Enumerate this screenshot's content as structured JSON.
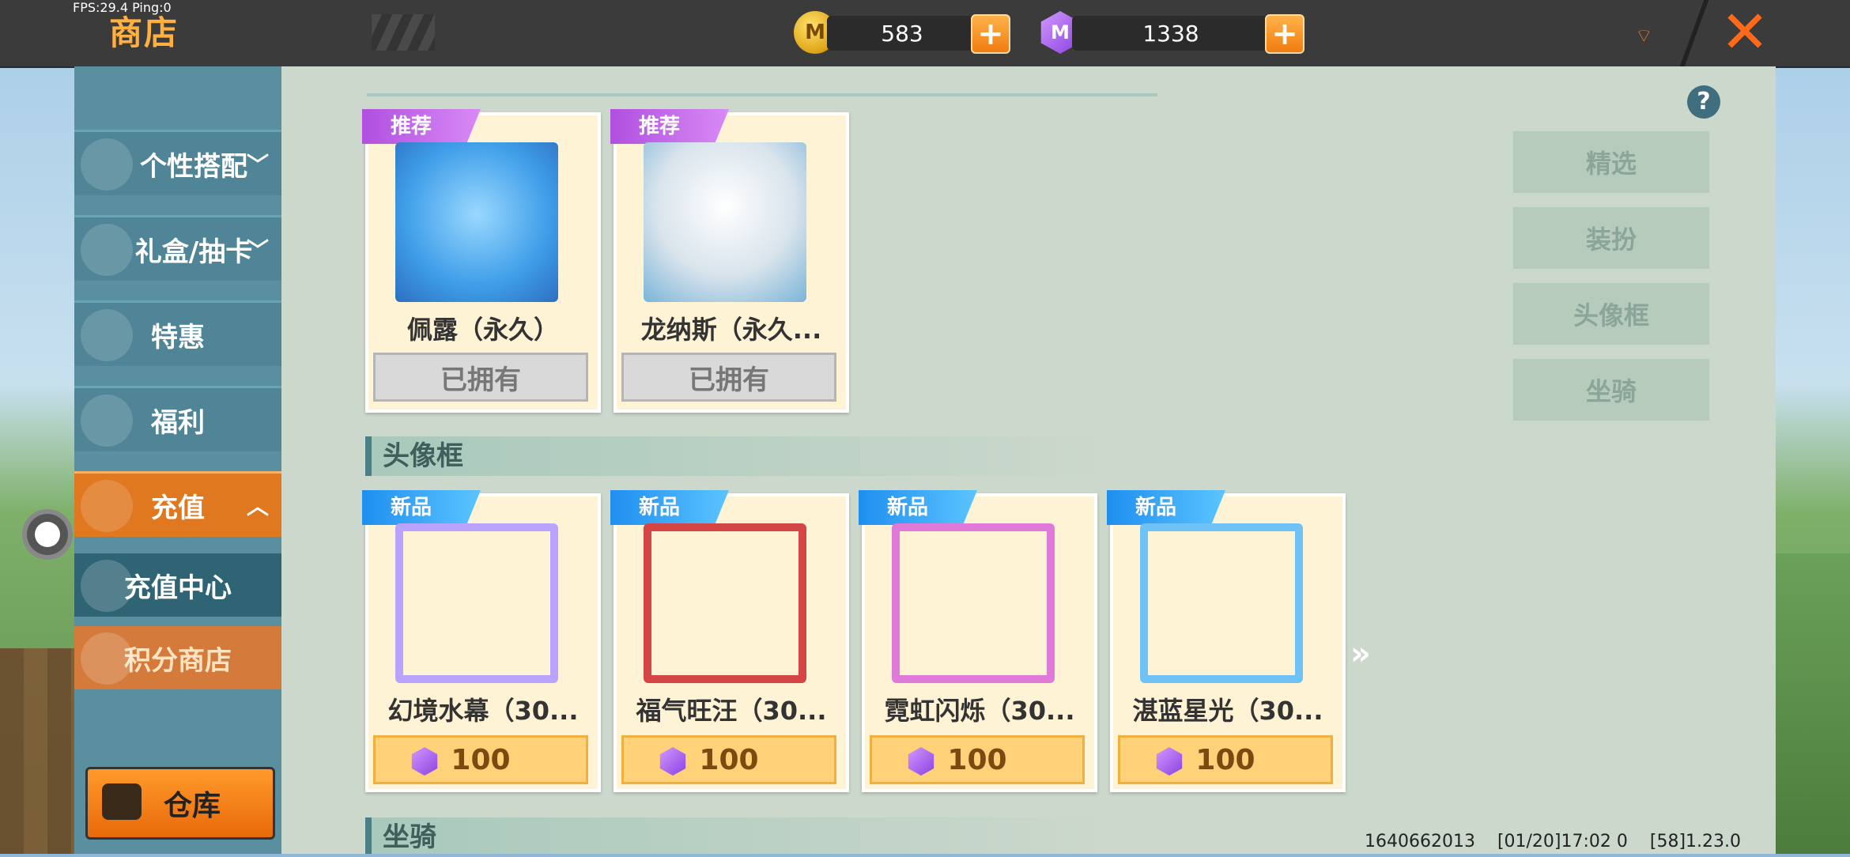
{
  "status": {
    "fps": "FPS:29.4  Ping:0"
  },
  "header": {
    "title": "商店",
    "coins": "583",
    "coin_icon_letter": "M",
    "gems": "1338",
    "gem_icon_letter": "M",
    "add_symbol": "+",
    "close_symbol": "✕",
    "rss_symbol": "⌔"
  },
  "sidebar": {
    "items": [
      {
        "label": "个性搭配",
        "icon": "trophy-icon",
        "chevron": "﹀"
      },
      {
        "label": "礼盒/抽卡",
        "icon": "wheel-icon",
        "chevron": "﹀"
      },
      {
        "label": "特惠",
        "icon": "box-icon"
      },
      {
        "label": "福利",
        "icon": "gift-icon"
      },
      {
        "label": "充值",
        "icon": "coins-icon",
        "chevron": "︿"
      }
    ],
    "sub_items": [
      {
        "label": "充值中心",
        "icon": "coins-icon"
      },
      {
        "label": "积分商店",
        "icon": "points-icon"
      }
    ],
    "warehouse_label": "仓库"
  },
  "filters": [
    "精选",
    "装扮",
    "头像框",
    "坐骑"
  ],
  "help_label": "?",
  "recommended": [
    {
      "tag": "推荐",
      "name": "佩露（永久）",
      "status": "已拥有"
    },
    {
      "tag": "推荐",
      "name": "龙纳斯（永久...",
      "status": "已拥有"
    }
  ],
  "sections": {
    "frames": "头像框",
    "mounts": "坐骑"
  },
  "frames": [
    {
      "tag": "新品",
      "name": "幻境水幕（30...",
      "price": "100"
    },
    {
      "tag": "新品",
      "name": "福气旺汪（30...",
      "price": "100"
    },
    {
      "tag": "新品",
      "name": "霓虹闪烁（30...",
      "price": "100"
    },
    {
      "tag": "新品",
      "name": "湛蓝星光（30...",
      "price": "100"
    }
  ],
  "next_symbol": "»",
  "footer": "1640662013    [01/20]17:02 0    [58]1.23.0"
}
